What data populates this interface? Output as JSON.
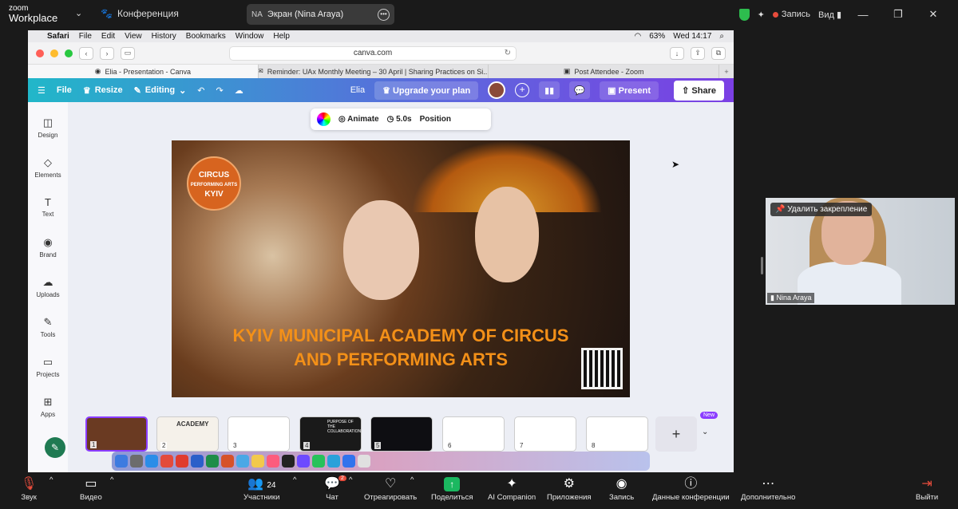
{
  "zoom": {
    "brand_top": "zoom",
    "brand_bottom": "Workplace",
    "conference_label": "Конференция",
    "share_initials": "NA",
    "share_label": "Экран (Nina Araya)",
    "record_label": "Запись",
    "view_label": "Вид",
    "win_minimize": "—",
    "win_restore": "❐",
    "win_close": "✕",
    "video": {
      "unpin_label": "Удалить закрепление",
      "participant_name": "Nina Araya"
    },
    "bottom": {
      "mute_label": "Звук",
      "video_label": "Видео",
      "participants_label": "Участники",
      "participants_count": "24",
      "chat_label": "Чат",
      "chat_badge": "2",
      "react_label": "Отреагировать",
      "share_label": "Поделиться",
      "ai_label": "AI Companion",
      "apps_label": "Приложения",
      "record_label": "Запись",
      "info_label": "Данные конференции",
      "more_label": "Дополнительно",
      "leave_label": "Выйти"
    }
  },
  "mac": {
    "menu": [
      "Safari",
      "File",
      "Edit",
      "View",
      "History",
      "Bookmarks",
      "Window",
      "Help"
    ],
    "battery": "63%",
    "clock": "Wed 14:17",
    "url": "canva.com",
    "tabs": [
      {
        "label": "Elia - Presentation - Canva",
        "active": true
      },
      {
        "label": "Reminder: UAx Monthly Meeting – 30 April | Sharing Practices on Si...",
        "active": false
      },
      {
        "label": "Post Attendee - Zoom",
        "active": false
      }
    ]
  },
  "canva": {
    "header": {
      "file_label": "File",
      "resize_label": "Resize",
      "editing_label": "Editing",
      "doc_title": "Elia",
      "upgrade_label": "Upgrade your plan",
      "present_label": "Present",
      "share_label": "Share"
    },
    "sidebar": [
      {
        "label": "Design",
        "icon": "design-icon"
      },
      {
        "label": "Elements",
        "icon": "elements-icon"
      },
      {
        "label": "Text",
        "icon": "text-icon"
      },
      {
        "label": "Brand",
        "icon": "brand-icon"
      },
      {
        "label": "Uploads",
        "icon": "uploads-icon"
      },
      {
        "label": "Tools",
        "icon": "tools-icon"
      },
      {
        "label": "Projects",
        "icon": "projects-icon"
      },
      {
        "label": "Apps",
        "icon": "apps-icon"
      }
    ],
    "context_toolbar": {
      "animate_label": "Animate",
      "duration": "5.0s",
      "position_label": "Position"
    },
    "slide": {
      "logo_text_1": "CIRCUS",
      "logo_text_2": "PERFORMING ARTS",
      "logo_text_3": "KYIV",
      "title_line1": "KYIV MUNICIPAL ACADEMY OF CIRCUS",
      "title_line2": "AND PERFORMING ARTS"
    },
    "pages": [
      {
        "num": "1",
        "bg": "#6a3a22"
      },
      {
        "num": "2",
        "bg": "#f5f1ea",
        "text": "ACADEMY"
      },
      {
        "num": "3",
        "bg": "#ffffff"
      },
      {
        "num": "4",
        "bg": "#1a1a1a",
        "text": "PURPOSE OF THE COLLABORATION"
      },
      {
        "num": "5",
        "bg": "#0e0e12"
      },
      {
        "num": "6",
        "bg": "#ffffff"
      },
      {
        "num": "7",
        "bg": "#ffffff"
      },
      {
        "num": "8",
        "bg": "#ffffff"
      }
    ],
    "new_tag": "New"
  }
}
